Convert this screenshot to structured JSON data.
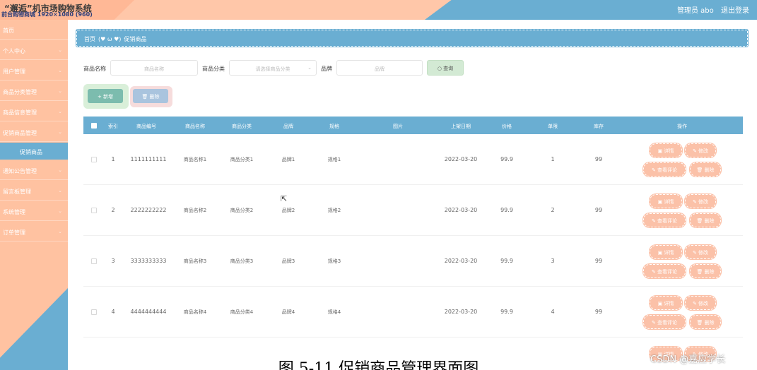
{
  "header": {
    "title": "“邂逅”机市场购物系统",
    "subtitle": "前台购物商城 1920×1080 (960)",
    "user_label": "管理员 abo",
    "logout_label": "退出登录"
  },
  "sidebar": {
    "items": [
      {
        "label": "首页",
        "has_chevron": false
      },
      {
        "label": "个人中心",
        "has_chevron": true
      },
      {
        "label": "用户管理",
        "has_chevron": true
      },
      {
        "label": "商品分类管理",
        "has_chevron": true
      },
      {
        "label": "商品信息管理",
        "has_chevron": true
      },
      {
        "label": "促销商品管理",
        "has_chevron": true
      },
      {
        "label": "通知公告管理",
        "has_chevron": true
      },
      {
        "label": "留言板管理",
        "has_chevron": true
      },
      {
        "label": "系统管理",
        "has_chevron": true
      },
      {
        "label": "订单管理",
        "has_chevron": true
      }
    ],
    "active_sub": "促销商品",
    "chevron": "⌄"
  },
  "breadcrumb": {
    "home": "首页",
    "separator": "(♥ ω ♥)",
    "current": "促销商品"
  },
  "search": {
    "name_label": "商品名称",
    "name_placeholder": "商品名称",
    "category_label": "商品分类",
    "category_placeholder": "请选择商品分类",
    "brand_label": "品牌",
    "brand_placeholder": "品牌",
    "search_label": "查询"
  },
  "actions": {
    "add_label": "新增",
    "delete_label": "删除"
  },
  "table": {
    "columns": [
      "索引",
      "商品编号",
      "商品名称",
      "商品分类",
      "品牌",
      "规格",
      "图片",
      "上架日期",
      "价格",
      "单限",
      "库存",
      "操作"
    ],
    "rows": [
      {
        "index": "1",
        "code": "1111111111",
        "name": "商品名称1",
        "category": "商品分类1",
        "brand": "品牌1",
        "spec": "规格1",
        "date": "2022-03-20",
        "price": "99.9",
        "limit": "1",
        "stock": "99"
      },
      {
        "index": "2",
        "code": "2222222222",
        "name": "商品名称2",
        "category": "商品分类2",
        "brand": "品牌2",
        "spec": "规格2",
        "date": "2022-03-20",
        "price": "99.9",
        "limit": "2",
        "stock": "99"
      },
      {
        "index": "3",
        "code": "3333333333",
        "name": "商品名称3",
        "category": "商品分类3",
        "brand": "品牌3",
        "spec": "规格3",
        "date": "2022-03-20",
        "price": "99.9",
        "limit": "3",
        "stock": "99"
      },
      {
        "index": "4",
        "code": "4444444444",
        "name": "商品名称4",
        "category": "商品分类4",
        "brand": "品牌4",
        "spec": "规格4",
        "date": "2022-03-20",
        "price": "99.9",
        "limit": "4",
        "stock": "99"
      }
    ],
    "row_buttons": {
      "detail": "详情",
      "edit": "修改",
      "comments": "查看评论",
      "delete": "删除"
    }
  },
  "icons": {
    "search": "○",
    "add": "+",
    "delete": "🗑",
    "detail": "▣",
    "edit": "✎",
    "cursor": "⇱"
  },
  "caption": "图 5-11 促销商品管理界面图",
  "watermark": "CSDN @嘉应学长",
  "colors": {
    "peach": "#ffc2a1",
    "blue": "#6aaed2",
    "green": "#7cbcae",
    "op_button": "#fbc1a8"
  }
}
